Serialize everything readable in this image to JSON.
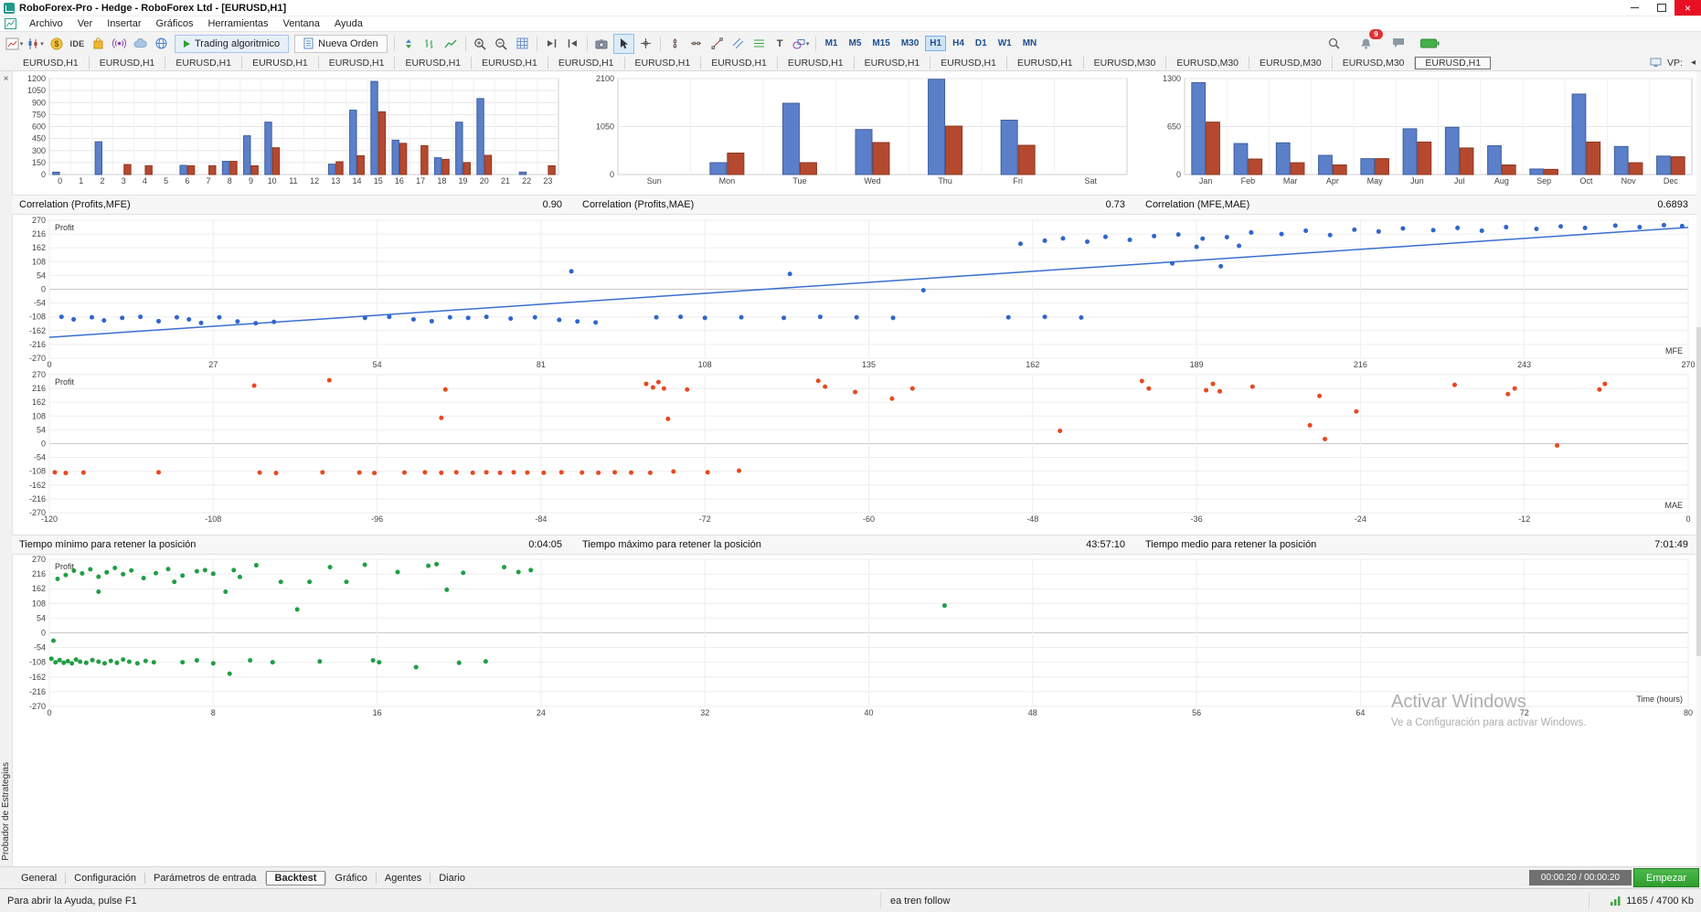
{
  "window": {
    "title": "RoboForex-Pro - Hedge - RoboForex Ltd - [EURUSD,H1]"
  },
  "menu": {
    "items": [
      "Archivo",
      "Ver",
      "Insertar",
      "Gráficos",
      "Herramientas",
      "Ventana",
      "Ayuda"
    ]
  },
  "toolbar": {
    "ide_label": "IDE",
    "algo_trading_label": "Trading algoritmico",
    "new_order_label": "Nueva Orden",
    "text_tool_label": "T",
    "timeframes": [
      "M1",
      "M5",
      "M15",
      "M30",
      "H1",
      "H4",
      "D1",
      "W1",
      "MN"
    ],
    "active_timeframe": "H1",
    "notification_count": "9"
  },
  "chart_tabs": {
    "tabs": [
      {
        "label": "EURUSD,H1",
        "active": false
      },
      {
        "label": "EURUSD,H1",
        "active": false
      },
      {
        "label": "EURUSD,H1",
        "active": false
      },
      {
        "label": "EURUSD,H1",
        "active": false
      },
      {
        "label": "EURUSD,H1",
        "active": false
      },
      {
        "label": "EURUSD,H1",
        "active": false
      },
      {
        "label": "EURUSD,H1",
        "active": false
      },
      {
        "label": "EURUSD,H1",
        "active": false
      },
      {
        "label": "EURUSD,H1",
        "active": false
      },
      {
        "label": "EURUSD,H1",
        "active": false
      },
      {
        "label": "EURUSD,H1",
        "active": false
      },
      {
        "label": "EURUSD,H1",
        "active": false
      },
      {
        "label": "EURUSD,H1",
        "active": false
      },
      {
        "label": "EURUSD,H1",
        "active": false
      },
      {
        "label": "EURUSD,M30",
        "active": false
      },
      {
        "label": "EURUSD,M30",
        "active": false
      },
      {
        "label": "EURUSD,M30",
        "active": false
      },
      {
        "label": "EURUSD,M30",
        "active": false
      },
      {
        "label": "EURUSD,H1",
        "active": true
      }
    ],
    "extra_label": "VP:",
    "scroll_left": "◂"
  },
  "tester": {
    "panel_label": "Probador de Estrategias",
    "close_label": "×",
    "correlations": [
      {
        "label": "Correlation (Profits,MFE)",
        "value": "0.90"
      },
      {
        "label": "Correlation (Profits,MAE)",
        "value": "0.73"
      },
      {
        "label": "Correlation (MFE,MAE)",
        "value": "0.6893"
      }
    ],
    "times": [
      {
        "label": "Tiempo mínimo para retener la posición",
        "value": "0:04:05"
      },
      {
        "label": "Tiempo máximo para retener la posición",
        "value": "43:57:10"
      },
      {
        "label": "Tiempo medio para retener la posición",
        "value": "7:01:49"
      }
    ],
    "tabs": [
      "General",
      "Configuración",
      "Parámetros de entrada",
      "Backtest",
      "Gráfico",
      "Agentes",
      "Diario"
    ],
    "active_tab": "Backtest",
    "progress": "00:00:20 / 00:00:20",
    "start_label": "Empezar"
  },
  "statusbar": {
    "help": "Para abrir la Ayuda, pulse F1",
    "ea_name": "ea tren follow",
    "memory": "1165 / 4700 Kb"
  },
  "watermark": {
    "line1": "Activar Windows",
    "line2": "Ve a Configuración para activar Windows."
  },
  "chart_data": [
    {
      "type": "bar",
      "id": "hours",
      "categories": [
        "0",
        "1",
        "2",
        "3",
        "4",
        "5",
        "6",
        "7",
        "8",
        "9",
        "10",
        "11",
        "12",
        "13",
        "14",
        "15",
        "16",
        "17",
        "18",
        "19",
        "20",
        "21",
        "22",
        "23"
      ],
      "series": [
        {
          "name": "profit",
          "color": "#5b7fc9",
          "border": "#3f5f9e",
          "values": [
            30,
            0,
            410,
            0,
            0,
            0,
            115,
            0,
            165,
            485,
            655,
            0,
            0,
            130,
            805,
            1165,
            430,
            0,
            210,
            655,
            950,
            0,
            30,
            0
          ]
        },
        {
          "name": "loss",
          "color": "#b5492f",
          "border": "#8c3721",
          "values": [
            0,
            0,
            0,
            125,
            110,
            0,
            110,
            110,
            165,
            110,
            335,
            0,
            0,
            160,
            235,
            785,
            390,
            360,
            190,
            150,
            240,
            0,
            0,
            110
          ]
        }
      ],
      "ylim": [
        0,
        1200
      ],
      "yticks": [
        0,
        150,
        300,
        450,
        600,
        750,
        900,
        1050,
        1200
      ]
    },
    {
      "type": "bar",
      "id": "days",
      "categories": [
        "Sun",
        "Mon",
        "Tue",
        "Wed",
        "Thu",
        "Fri",
        "Sat"
      ],
      "series": [
        {
          "name": "profit",
          "color": "#5b7fc9",
          "border": "#3f5f9e",
          "values": [
            0,
            260,
            1560,
            985,
            2085,
            1190,
            0
          ]
        },
        {
          "name": "loss",
          "color": "#b5492f",
          "border": "#8c3721",
          "values": [
            0,
            470,
            260,
            700,
            1060,
            640,
            0
          ]
        }
      ],
      "ylim": [
        0,
        2100
      ],
      "yticks": [
        0,
        1050,
        2100
      ]
    },
    {
      "type": "bar",
      "id": "months",
      "categories": [
        "Jan",
        "Feb",
        "Mar",
        "Apr",
        "May",
        "Jun",
        "Jul",
        "Aug",
        "Sep",
        "Oct",
        "Nov",
        "Dec"
      ],
      "series": [
        {
          "name": "profit",
          "color": "#5b7fc9",
          "border": "#3f5f9e",
          "values": [
            1245,
            420,
            430,
            260,
            215,
            620,
            640,
            390,
            75,
            1090,
            380,
            250
          ]
        },
        {
          "name": "loss",
          "color": "#b5492f",
          "border": "#8c3721",
          "values": [
            710,
            210,
            160,
            130,
            215,
            440,
            360,
            130,
            70,
            440,
            160,
            240
          ]
        }
      ],
      "ylim": [
        0,
        1300
      ],
      "yticks": [
        0,
        650,
        1300
      ]
    },
    {
      "type": "scatter",
      "id": "mfe",
      "ylabel": "Profit",
      "xlabel": "MFE",
      "color": "#2f66cc",
      "xlim": [
        0,
        270
      ],
      "xticks": [
        0,
        27,
        54,
        81,
        108,
        135,
        162,
        189,
        216,
        243,
        270
      ],
      "ylim": [
        -270,
        270
      ],
      "yticks": [
        270,
        216,
        162,
        108,
        54,
        0,
        -54,
        -108,
        -162,
        -216,
        -270
      ],
      "trend": [
        [
          0,
          -188
        ],
        [
          270,
          242
        ]
      ],
      "trend_color": "#3a6fd0",
      "points": [
        [
          2,
          -108
        ],
        [
          4,
          -118
        ],
        [
          7,
          -110
        ],
        [
          9,
          -122
        ],
        [
          12,
          -112
        ],
        [
          15,
          -108
        ],
        [
          18,
          -125
        ],
        [
          21,
          -110
        ],
        [
          23,
          -118
        ],
        [
          25,
          -132
        ],
        [
          28,
          -110
        ],
        [
          31,
          -126
        ],
        [
          34,
          -133
        ],
        [
          37,
          -128
        ],
        [
          52,
          -112
        ],
        [
          56,
          -108
        ],
        [
          60,
          -118
        ],
        [
          63,
          -125
        ],
        [
          66,
          -110
        ],
        [
          69,
          -112
        ],
        [
          72,
          -108
        ],
        [
          76,
          -115
        ],
        [
          80,
          -110
        ],
        [
          84,
          -120
        ],
        [
          87,
          -126
        ],
        [
          90,
          -130
        ],
        [
          100,
          -110
        ],
        [
          104,
          -108
        ],
        [
          108,
          -112
        ],
        [
          114,
          -110
        ],
        [
          121,
          -112
        ],
        [
          127,
          -108
        ],
        [
          133,
          -110
        ],
        [
          139,
          -112
        ],
        [
          158,
          -110
        ],
        [
          164,
          -108
        ],
        [
          170,
          -111
        ],
        [
          86,
          70
        ],
        [
          122,
          60
        ],
        [
          144,
          -4
        ],
        [
          185,
          101
        ],
        [
          193,
          90
        ],
        [
          160,
          178
        ],
        [
          164,
          190
        ],
        [
          167,
          199
        ],
        [
          171,
          186
        ],
        [
          174,
          205
        ],
        [
          178,
          193
        ],
        [
          182,
          208
        ],
        [
          186,
          214
        ],
        [
          189,
          166
        ],
        [
          196,
          170
        ],
        [
          190,
          198
        ],
        [
          194,
          204
        ],
        [
          198,
          222
        ],
        [
          203,
          216
        ],
        [
          207,
          229
        ],
        [
          211,
          212
        ],
        [
          215,
          233
        ],
        [
          219,
          226
        ],
        [
          223,
          238
        ],
        [
          228,
          231
        ],
        [
          232,
          240
        ],
        [
          236,
          229
        ],
        [
          240,
          243
        ],
        [
          245,
          236
        ],
        [
          249,
          246
        ],
        [
          253,
          240
        ],
        [
          258,
          249
        ],
        [
          262,
          243
        ],
        [
          266,
          251
        ],
        [
          269,
          247
        ]
      ]
    },
    {
      "type": "scatter",
      "id": "mae",
      "ylabel": "Profit",
      "xlabel": "MAE",
      "color": "#e8481f",
      "xlim": [
        -120,
        0
      ],
      "xticks": [
        -120,
        -108,
        -96,
        -84,
        -72,
        -60,
        -48,
        -36,
        -24,
        -12,
        0
      ],
      "ylim": [
        -270,
        270
      ],
      "yticks": [
        270,
        216,
        162,
        108,
        54,
        0,
        -54,
        -108,
        -162,
        -216,
        -270
      ],
      "points": [
        [
          -119.6,
          -112
        ],
        [
          -118.8,
          -115
        ],
        [
          -117.5,
          -113
        ],
        [
          -112,
          -112
        ],
        [
          -104.6,
          -113
        ],
        [
          -103.4,
          -115
        ],
        [
          -100,
          -112
        ],
        [
          -97.3,
          -113
        ],
        [
          -96.2,
          -115
        ],
        [
          -94,
          -113
        ],
        [
          -92.5,
          -112
        ],
        [
          -91.3,
          -114
        ],
        [
          -90.2,
          -112
        ],
        [
          -89,
          -114
        ],
        [
          -88,
          -112
        ],
        [
          -87,
          -114
        ],
        [
          -86,
          -112
        ],
        [
          -85,
          -113
        ],
        [
          -83.8,
          -114
        ],
        [
          -82.5,
          -112
        ],
        [
          -81,
          -113
        ],
        [
          -79.8,
          -114
        ],
        [
          -78.6,
          -112
        ],
        [
          -77.4,
          -113
        ],
        [
          -76,
          -114
        ],
        [
          -74.3,
          -109
        ],
        [
          -71.8,
          -112
        ],
        [
          -69.5,
          -106
        ],
        [
          -105,
          227
        ],
        [
          -99.5,
          248
        ],
        [
          -91,
          212
        ],
        [
          -91.3,
          101
        ],
        [
          -76.3,
          234
        ],
        [
          -75.8,
          220
        ],
        [
          -75.4,
          241
        ],
        [
          -75,
          216
        ],
        [
          -74.7,
          97
        ],
        [
          -73.3,
          212
        ],
        [
          -63.7,
          246
        ],
        [
          -63.2,
          223
        ],
        [
          -61,
          202
        ],
        [
          -58.3,
          176
        ],
        [
          -56.8,
          216
        ],
        [
          -46,
          50
        ],
        [
          -40,
          245
        ],
        [
          -39.5,
          216
        ],
        [
          -35.3,
          209
        ],
        [
          -34.8,
          234
        ],
        [
          -34.3,
          205
        ],
        [
          -31.9,
          223
        ],
        [
          -27.7,
          72
        ],
        [
          -27,
          187
        ],
        [
          -26.6,
          18
        ],
        [
          -24.3,
          126
        ],
        [
          -17.1,
          230
        ],
        [
          -13.2,
          194
        ],
        [
          -12.7,
          216
        ],
        [
          -9.6,
          -7
        ],
        [
          -6.5,
          212
        ],
        [
          -6.1,
          234
        ]
      ]
    },
    {
      "type": "scatter",
      "id": "time",
      "ylabel": "Profit",
      "xlabel": "Time (hours)",
      "color": "#1f9e43",
      "xlim": [
        0,
        80
      ],
      "xticks": [
        0,
        8,
        16,
        24,
        32,
        40,
        48,
        56,
        64,
        72,
        80
      ],
      "ylim": [
        -270,
        270
      ],
      "yticks": [
        270,
        216,
        162,
        108,
        54,
        0,
        -54,
        -108,
        -162,
        -216,
        -270
      ],
      "points": [
        [
          0.2,
          -29
        ],
        [
          0.1,
          -95
        ],
        [
          0.3,
          -108
        ],
        [
          0.5,
          -100
        ],
        [
          0.7,
          -110
        ],
        [
          0.9,
          -104
        ],
        [
          1.1,
          -112
        ],
        [
          1.3,
          -98
        ],
        [
          1.5,
          -106
        ],
        [
          1.8,
          -110
        ],
        [
          2.1,
          -100
        ],
        [
          2.4,
          -106
        ],
        [
          2.7,
          -112
        ],
        [
          3,
          -103
        ],
        [
          3.3,
          -110
        ],
        [
          3.6,
          -98
        ],
        [
          3.9,
          -106
        ],
        [
          4.3,
          -112
        ],
        [
          4.7,
          -103
        ],
        [
          5.1,
          -108
        ],
        [
          6.5,
          -108
        ],
        [
          7.2,
          -101
        ],
        [
          8,
          -112
        ],
        [
          8.8,
          -150
        ],
        [
          9.8,
          -101
        ],
        [
          10.9,
          -108
        ],
        [
          13.2,
          -105
        ],
        [
          15.8,
          -101
        ],
        [
          16.1,
          -108
        ],
        [
          17.9,
          -126
        ],
        [
          20,
          -110
        ],
        [
          21.3,
          -105
        ],
        [
          0.4,
          198
        ],
        [
          0.8,
          212
        ],
        [
          1.2,
          228
        ],
        [
          1.6,
          218
        ],
        [
          2,
          233
        ],
        [
          2.4,
          206
        ],
        [
          2.8,
          222
        ],
        [
          3.2,
          238
        ],
        [
          3.6,
          215
        ],
        [
          4,
          229
        ],
        [
          4.6,
          201
        ],
        [
          5.2,
          219
        ],
        [
          5.8,
          234
        ],
        [
          6.5,
          210
        ],
        [
          7.2,
          226
        ],
        [
          8,
          217
        ],
        [
          9,
          230
        ],
        [
          2.4,
          151
        ],
        [
          6.1,
          187
        ],
        [
          7.6,
          230
        ],
        [
          8.6,
          151
        ],
        [
          9.3,
          205
        ],
        [
          10.1,
          248
        ],
        [
          11.3,
          187
        ],
        [
          12.1,
          86
        ],
        [
          12.7,
          187
        ],
        [
          13.7,
          241
        ],
        [
          14.5,
          187
        ],
        [
          15.4,
          250
        ],
        [
          17,
          223
        ],
        [
          18.5,
          246
        ],
        [
          18.9,
          252
        ],
        [
          19.4,
          158
        ],
        [
          20.2,
          220
        ],
        [
          22.2,
          241
        ],
        [
          22.9,
          223
        ],
        [
          23.5,
          230
        ],
        [
          43.7,
          100
        ]
      ]
    }
  ]
}
